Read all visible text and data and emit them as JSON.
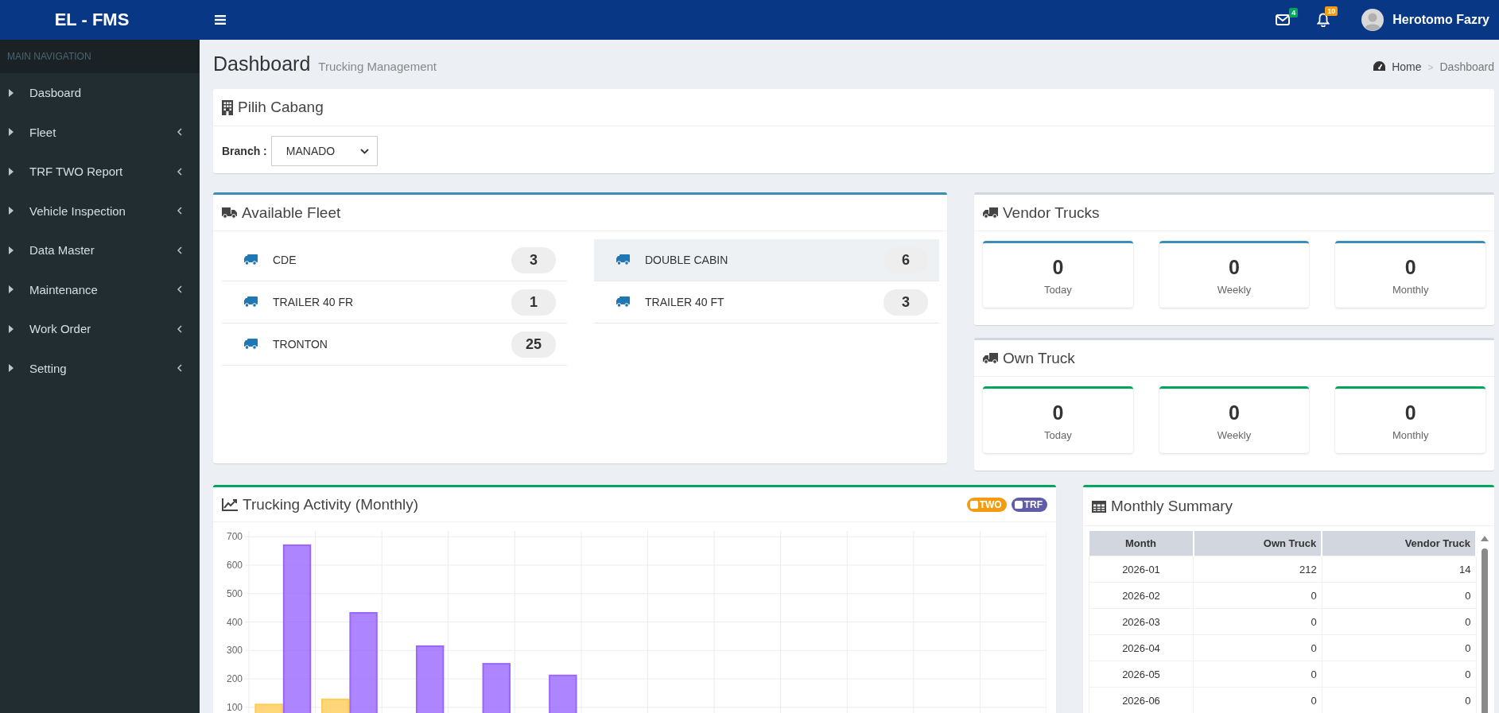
{
  "topbar": {
    "logo": "EL - FMS",
    "messages_badge": "4",
    "notifications_badge": "10",
    "user_name": "Herotomo Fazry"
  },
  "sidebar": {
    "header": "MAIN NAVIGATION",
    "items": [
      {
        "label": "Dasboard",
        "has_submenu": false
      },
      {
        "label": "Fleet",
        "has_submenu": true
      },
      {
        "label": "TRF TWO Report",
        "has_submenu": true
      },
      {
        "label": "Vehicle Inspection",
        "has_submenu": true
      },
      {
        "label": "Data Master",
        "has_submenu": true
      },
      {
        "label": "Maintenance",
        "has_submenu": true
      },
      {
        "label": "Work Order",
        "has_submenu": true
      },
      {
        "label": "Setting",
        "has_submenu": true
      }
    ]
  },
  "page_header": {
    "title": "Dashboard",
    "subtitle": "Trucking Management",
    "breadcrumb": [
      "Home",
      "Dashboard"
    ],
    "breadcrumb_separator": ">"
  },
  "branch_card": {
    "title": "Pilih Cabang",
    "label": "Branch :",
    "value": "MANADO"
  },
  "available_fleet": {
    "title": "Available Fleet",
    "columns": [
      [
        {
          "name": "CDE",
          "count": "3",
          "highlighted": false
        },
        {
          "name": "TRAILER 40 FR",
          "count": "1",
          "highlighted": false
        },
        {
          "name": "TRONTON",
          "count": "25",
          "highlighted": false
        }
      ],
      [
        {
          "name": "DOUBLE CABIN",
          "count": "6",
          "highlighted": true
        },
        {
          "name": "TRAILER 40 FT",
          "count": "3",
          "highlighted": false
        }
      ]
    ]
  },
  "truck_panels": [
    {
      "kind": "vendor",
      "title": "Vendor Trucks",
      "stats": [
        {
          "value": "0",
          "label": "Today"
        },
        {
          "value": "0",
          "label": "Weekly"
        },
        {
          "value": "0",
          "label": "Monthly"
        }
      ]
    },
    {
      "kind": "own",
      "title": "Own Truck",
      "stats": [
        {
          "value": "0",
          "label": "Today"
        },
        {
          "value": "0",
          "label": "Weekly"
        },
        {
          "value": "0",
          "label": "Monthly"
        }
      ]
    }
  ],
  "trucking_activity": {
    "title": "Trucking Activity (Monthly)",
    "chart_data": {
      "type": "bar",
      "grid": true,
      "ylim": [
        80,
        720
      ],
      "yticks": [
        100,
        200,
        300,
        400,
        500,
        600,
        700
      ],
      "series": [
        {
          "name": "TWO",
          "color": "#ffcd56",
          "values": [
            110,
            128,
            null,
            null,
            null,
            null,
            null,
            null,
            null,
            null,
            null,
            null
          ]
        },
        {
          "name": "TRF",
          "color": "#9966ff",
          "values": [
            670,
            432,
            315,
            253,
            212,
            null,
            null,
            null,
            null,
            null,
            null,
            null
          ]
        }
      ]
    }
  },
  "monthly_summary": {
    "title": "Monthly Summary",
    "columns": [
      "Month",
      "Own Truck",
      "Vendor Truck"
    ],
    "rows": [
      [
        "2026-01",
        "212",
        "14"
      ],
      [
        "2026-02",
        "0",
        "0"
      ],
      [
        "2026-03",
        "0",
        "0"
      ],
      [
        "2026-04",
        "0",
        "0"
      ],
      [
        "2026-05",
        "0",
        "0"
      ],
      [
        "2026-06",
        "0",
        "0"
      ]
    ]
  }
}
